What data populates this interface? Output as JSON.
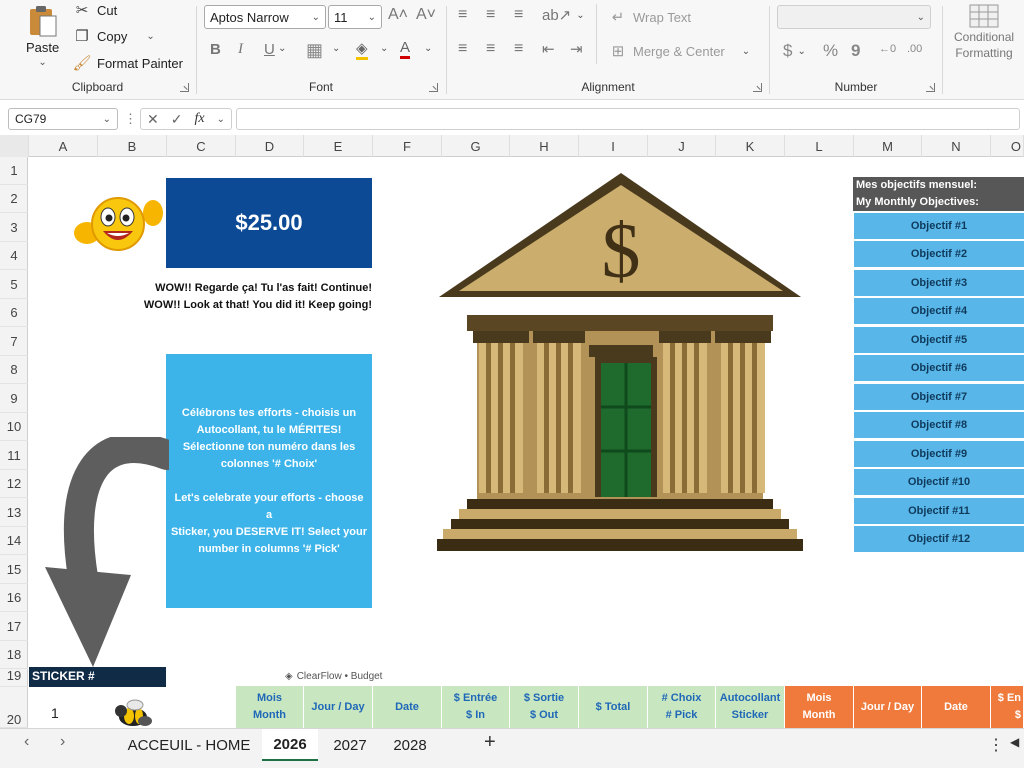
{
  "ribbon": {
    "clipboard": {
      "paste": "Paste",
      "cut": "Cut",
      "copy": "Copy",
      "format_painter": "Format Painter",
      "label": "Clipboard"
    },
    "font": {
      "name": "Aptos Narrow",
      "size": "11",
      "label": "Font"
    },
    "alignment": {
      "wrap_text": "Wrap Text",
      "merge_center": "Merge & Center",
      "label": "Alignment"
    },
    "number": {
      "label": "Number",
      "format": ""
    },
    "conditional": {
      "line1": "Conditional",
      "line2": "Formatting"
    }
  },
  "formula_bar": {
    "name_box": "CG79",
    "fx": "fx",
    "formula": ""
  },
  "columns": [
    "A",
    "B",
    "C",
    "D",
    "E",
    "F",
    "G",
    "H",
    "I",
    "J",
    "K",
    "L",
    "M",
    "N",
    "O"
  ],
  "rows": [
    "1",
    "2",
    "3",
    "4",
    "5",
    "6",
    "7",
    "8",
    "9",
    "10",
    "11",
    "12",
    "13",
    "14",
    "15",
    "16",
    "17",
    "18",
    "19",
    "20"
  ],
  "sheet": {
    "amount": "$25.00",
    "wow_fr": "WOW!! Regarde ça! Tu l'as fait! Continue!",
    "wow_en": "WOW!! Look at that! You did it! Keep going!",
    "celebrate": [
      "Célébrons tes efforts - choisis un",
      "Autocollant, tu le MÉRITES!",
      "Sélectionne ton numéro dans les",
      "colonnes '# Choix'",
      "",
      "Let's celebrate your efforts - choose a",
      "Sticker, you DESERVE IT! Select your",
      "number in columns '# Pick'"
    ],
    "objectives_header_fr": "Mes objectifs mensuel:",
    "objectives_header_en": "My Monthly Objectives:",
    "objectives": [
      "Objectif #1",
      "Objectif #2",
      "Objectif #3",
      "Objectif #4",
      "Objectif #5",
      "Objectif #6",
      "Objectif #7",
      "Objectif #8",
      "Objectif #9",
      "Objectif #10",
      "Objectif #11",
      "Objectif #12"
    ],
    "bank_symbol": "$",
    "sticker_header": "STICKER #",
    "watermark": "ClearFlow • Budget",
    "row20_number": "1",
    "table_headers": [
      {
        "l1": "Mois",
        "l2": "Month",
        "tone": "green"
      },
      {
        "l1": "Jour / Day",
        "l2": "",
        "tone": "green"
      },
      {
        "l1": "Date",
        "l2": "",
        "tone": "green"
      },
      {
        "l1": "$ Entrée",
        "l2": "$ In",
        "tone": "green"
      },
      {
        "l1": "$ Sortie",
        "l2": "$ Out",
        "tone": "green"
      },
      {
        "l1": "$ Total",
        "l2": "",
        "tone": "green"
      },
      {
        "l1": "# Choix",
        "l2": "# Pick",
        "tone": "green"
      },
      {
        "l1": "Autocollant",
        "l2": "Sticker",
        "tone": "green"
      },
      {
        "l1": "Mois",
        "l2": "Month",
        "tone": "orange"
      },
      {
        "l1": "Jour / Day",
        "l2": "",
        "tone": "orange"
      },
      {
        "l1": "Date",
        "l2": "",
        "tone": "orange"
      },
      {
        "l1": "$ En",
        "l2": "$",
        "tone": "orange"
      }
    ]
  },
  "tabs": [
    "ACCEUIL - HOME",
    "2026",
    "2027",
    "2028"
  ],
  "active_tab": "2026",
  "colors": {
    "amount_bg": "#0d4a95",
    "info_bg": "#3cb4ea",
    "objective_bg": "#58b6e8",
    "green_header": "#c8e7c0",
    "orange_header": "#f07a3c",
    "sticker_header_bg": "#0f2b46"
  }
}
